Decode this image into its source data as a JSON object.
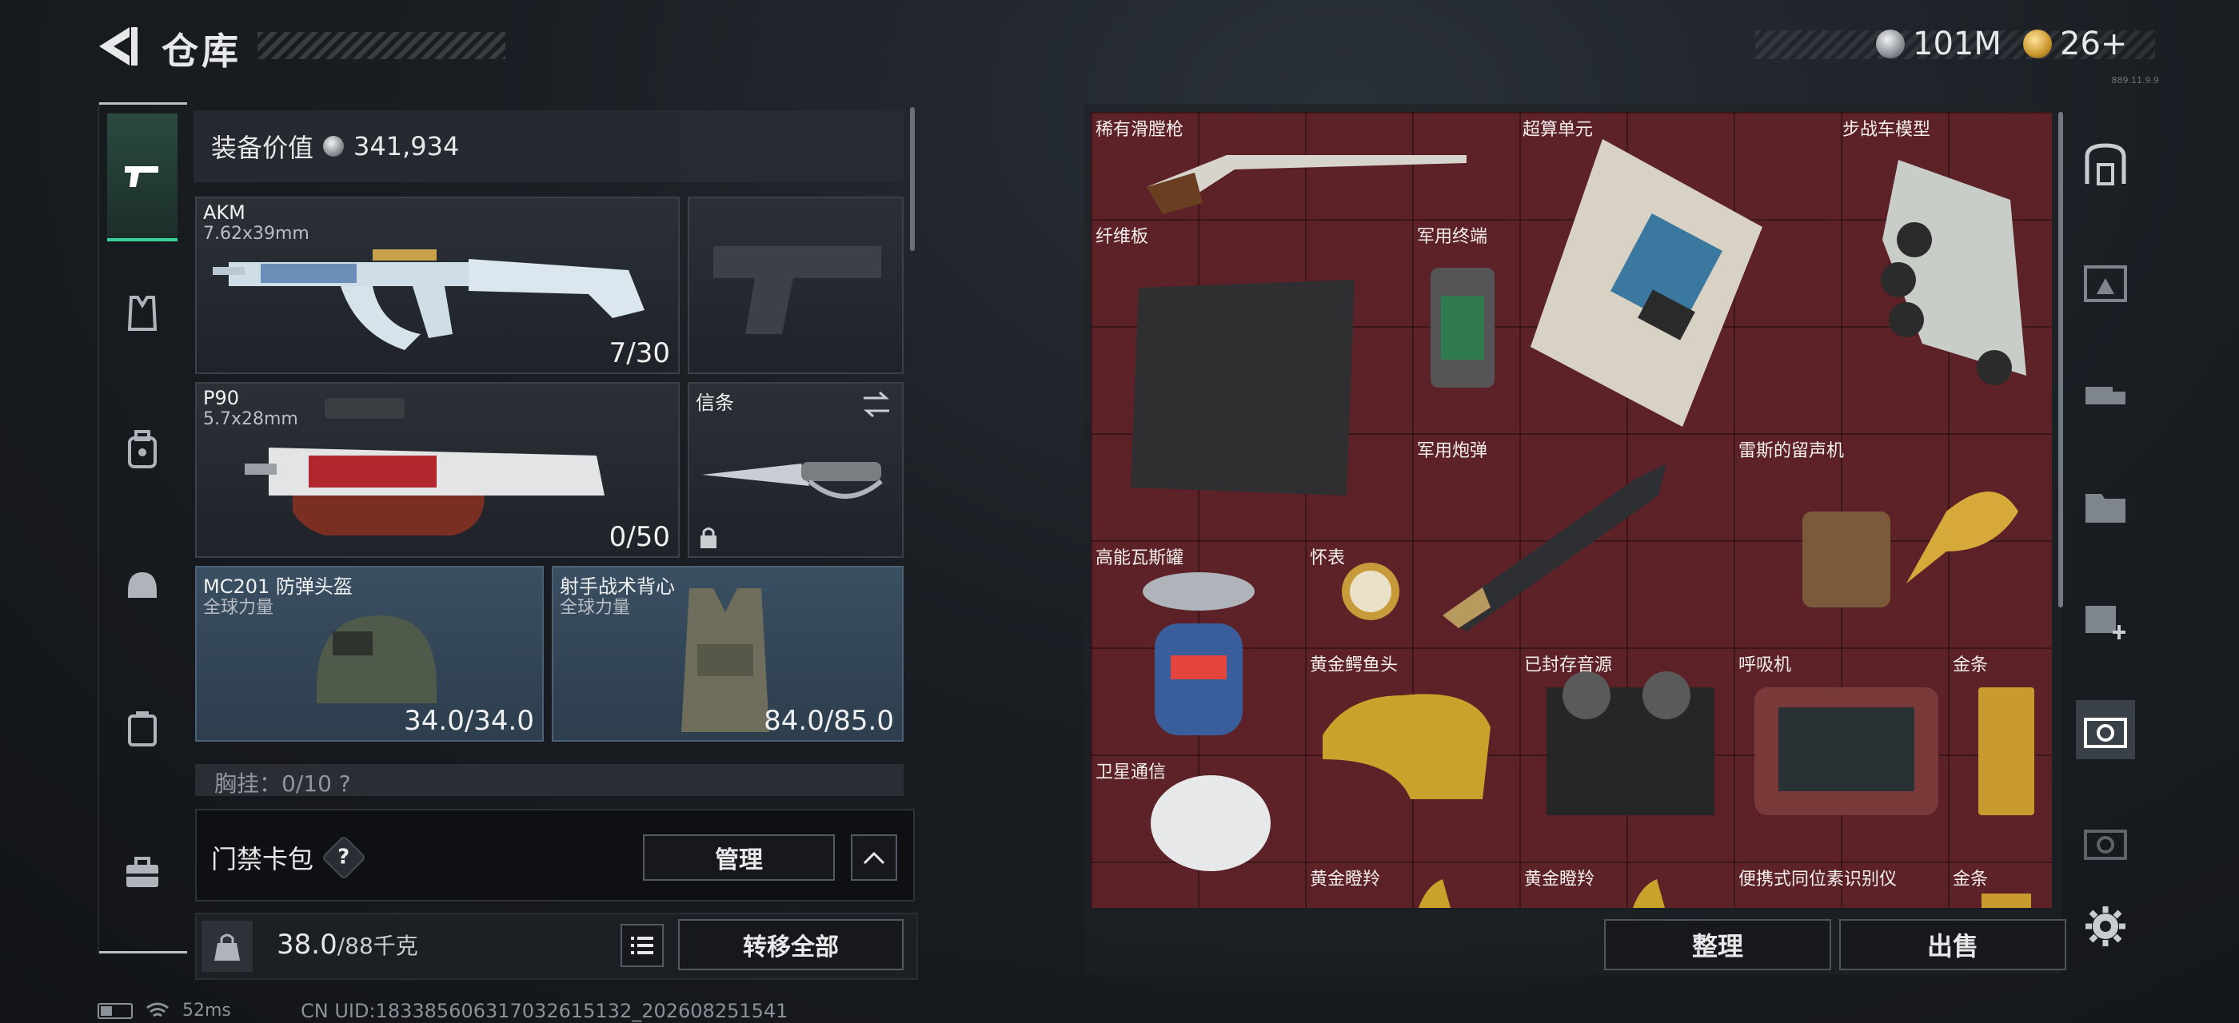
{
  "header": {
    "title": "仓库",
    "currency_silver": "101M",
    "currency_gold": "26+",
    "version": "889.11.9.9"
  },
  "loadout": {
    "equip_value_label": "装备价值",
    "equip_value": "341,934",
    "primary": {
      "name": "AKM",
      "caliber": "7.62x39mm",
      "ammo": "7/30"
    },
    "secondary": {
      "name": "P90",
      "caliber": "5.7x28mm",
      "ammo": "0/50"
    },
    "melee": {
      "name": "信条"
    },
    "helmet": {
      "name": "MC201 防弹头盔",
      "faction": "全球力量",
      "durability": "34.0/34.0"
    },
    "vest": {
      "name": "射手战术背心",
      "faction": "全球力量",
      "durability": "84.0/85.0"
    },
    "chest_rig_peek": "胸挂：0/10 ?",
    "keycard_label": "门禁卡包",
    "help": "?",
    "manage_label": "管理",
    "weight": "38.0",
    "weight_max": "/88千克",
    "transfer_all": "转移全部"
  },
  "storage": {
    "items": [
      {
        "label": "稀有滑膛枪"
      },
      {
        "label": "超算单元"
      },
      {
        "label": "步战车模型"
      },
      {
        "label": "纤维板"
      },
      {
        "label": "军用终端"
      },
      {
        "label": "军用炮弹"
      },
      {
        "label": "雷斯的留声机"
      },
      {
        "label": "高能瓦斯罐"
      },
      {
        "label": "怀表"
      },
      {
        "label": "黄金鳄鱼头"
      },
      {
        "label": "已封存音源"
      },
      {
        "label": "呼吸机"
      },
      {
        "label": "金条"
      },
      {
        "label": "卫星通信"
      },
      {
        "label": "黄金瞪羚"
      },
      {
        "label": "黄金瞪羚"
      },
      {
        "label": "便携式同位素识别仪"
      },
      {
        "label": "金条"
      }
    ],
    "sort_label": "整理",
    "sell_label": "出售"
  },
  "status_bar": {
    "ping": "52ms",
    "uid": "CN UID:18338560631703261513​2_202608251541"
  },
  "colors": {
    "accent": "#39d39a",
    "grid_bg": "#5c2227",
    "armor_bg": "#3a4f62"
  }
}
